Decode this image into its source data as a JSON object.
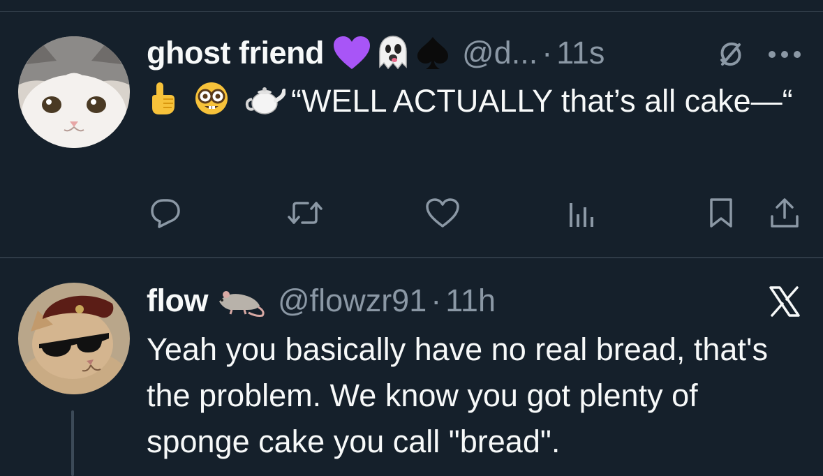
{
  "tweets": [
    {
      "display_name": "ghost friend",
      "handle": "@d...",
      "separator": "·",
      "time": "11s",
      "text": "“WELL ACTUALLY that’s all cake—“",
      "emoji_icons": [
        "point-up-emoji",
        "nerd-face-emoji",
        "teapot-emoji"
      ],
      "name_badges": [
        "purple-heart-emoji",
        "ghost-emoji",
        "spade-emoji"
      ],
      "header_icons": [
        "grok-icon",
        "more-icon"
      ],
      "actions": [
        "reply-icon",
        "retweet-icon",
        "like-icon",
        "views-icon",
        "bookmark-icon",
        "share-icon"
      ]
    },
    {
      "display_name": "flow",
      "handle": "@flowzr91",
      "separator": "·",
      "time": "11h",
      "text": "Yeah you basically have no real bread, that's the problem. We know you got plenty of sponge cake you call \"bread\".",
      "name_badges": [
        "rat-emoji"
      ],
      "header_icons": [
        "x-logo-icon"
      ]
    }
  ],
  "colors": {
    "background": "#15202b",
    "text": "#f7f9f9",
    "secondary": "#8b98a5",
    "divider": "#2f3b47",
    "purple_heart": "#a855f7"
  }
}
